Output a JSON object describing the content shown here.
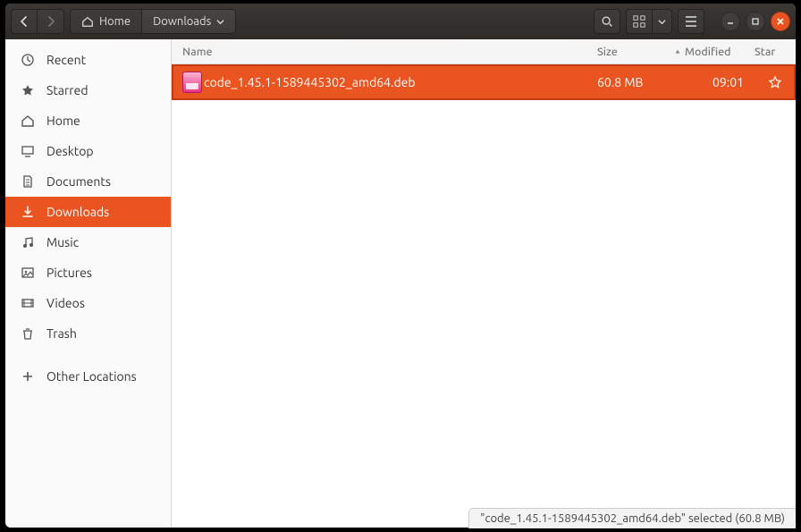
{
  "header": {
    "path": [
      {
        "label": "Home",
        "icon": "home"
      },
      {
        "label": "Downloads",
        "dropdown": true
      }
    ]
  },
  "sidebar": {
    "items": [
      {
        "id": "recent",
        "label": "Recent",
        "icon": "clock"
      },
      {
        "id": "starred",
        "label": "Starred",
        "icon": "star"
      },
      {
        "id": "home",
        "label": "Home",
        "icon": "home"
      },
      {
        "id": "desktop",
        "label": "Desktop",
        "icon": "desktop"
      },
      {
        "id": "documents",
        "label": "Documents",
        "icon": "document"
      },
      {
        "id": "downloads",
        "label": "Downloads",
        "icon": "download",
        "active": true
      },
      {
        "id": "music",
        "label": "Music",
        "icon": "music"
      },
      {
        "id": "pictures",
        "label": "Pictures",
        "icon": "picture"
      },
      {
        "id": "videos",
        "label": "Videos",
        "icon": "video"
      },
      {
        "id": "trash",
        "label": "Trash",
        "icon": "trash"
      },
      {
        "id": "other",
        "label": "Other Locations",
        "icon": "plus"
      }
    ]
  },
  "columns": {
    "name": "Name",
    "size": "Size",
    "modified": "Modified",
    "star": "Star"
  },
  "files": [
    {
      "name": "code_1.45.1-1589445302_amd64.deb",
      "size": "60.8 MB",
      "modified": "09:01",
      "starred": false,
      "selected": true
    }
  ],
  "status": "\"code_1.45.1-1589445302_amd64.deb\" selected  (60.8 MB)"
}
